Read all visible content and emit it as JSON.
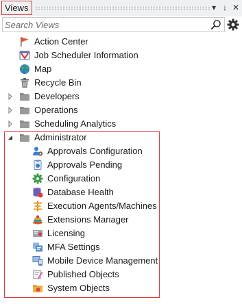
{
  "panel": {
    "title": "Views",
    "pin_glyph": "↓",
    "menu_glyph": "▾",
    "close_glyph": "✕"
  },
  "search": {
    "placeholder": "Search Views",
    "value": ""
  },
  "tree": {
    "top_items": [
      {
        "label": "Action Center",
        "icon": "flag-icon"
      },
      {
        "label": "Job Scheduler Information",
        "icon": "job-scheduler-icon"
      },
      {
        "label": "Map",
        "icon": "globe-icon"
      },
      {
        "label": "Recycle Bin",
        "icon": "trash-icon"
      }
    ],
    "folders": [
      {
        "label": "Developers",
        "expanded": false
      },
      {
        "label": "Operations",
        "expanded": false
      },
      {
        "label": "Scheduling Analytics",
        "expanded": false
      },
      {
        "label": "Administrator",
        "expanded": true
      }
    ],
    "admin_children": [
      {
        "label": "Approvals Configuration",
        "icon": "approvals-config-icon"
      },
      {
        "label": "Approvals Pending",
        "icon": "approvals-pending-icon"
      },
      {
        "label": "Configuration",
        "icon": "configuration-icon"
      },
      {
        "label": "Database Health",
        "icon": "database-health-icon"
      },
      {
        "label": "Execution Agents/Machines",
        "icon": "agents-icon"
      },
      {
        "label": "Extensions Manager",
        "icon": "extensions-icon"
      },
      {
        "label": "Licensing",
        "icon": "licensing-icon"
      },
      {
        "label": "MFA Settings",
        "icon": "mfa-icon"
      },
      {
        "label": "Mobile Device Management",
        "icon": "mobile-device-icon"
      },
      {
        "label": "Published Objects",
        "icon": "published-icon"
      },
      {
        "label": "System Objects",
        "icon": "system-objects-icon"
      }
    ]
  }
}
